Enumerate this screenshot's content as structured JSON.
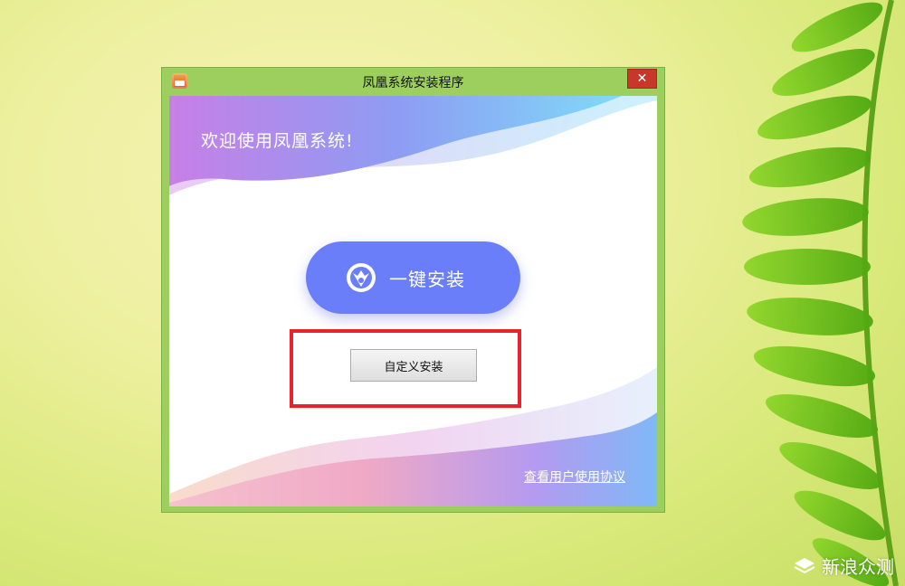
{
  "window": {
    "title": "凤凰系统安装程序",
    "close_glyph": "✕",
    "welcome_text": "欢迎使用凤凰系统!",
    "one_click_install_label": "一键安装",
    "custom_install_label": "自定义安装",
    "user_agreement_link": "查看用户使用协议"
  },
  "watermark": {
    "text": "新浪众测"
  },
  "colors": {
    "window_frame": "#9ccf5d",
    "close_button": "#c7382b",
    "install_button": "#6a7ef9",
    "highlight_box": "#e8232b"
  },
  "icons": [
    "app-icon",
    "close-icon",
    "phoenix-logo-icon",
    "watermark-logo-icon"
  ]
}
